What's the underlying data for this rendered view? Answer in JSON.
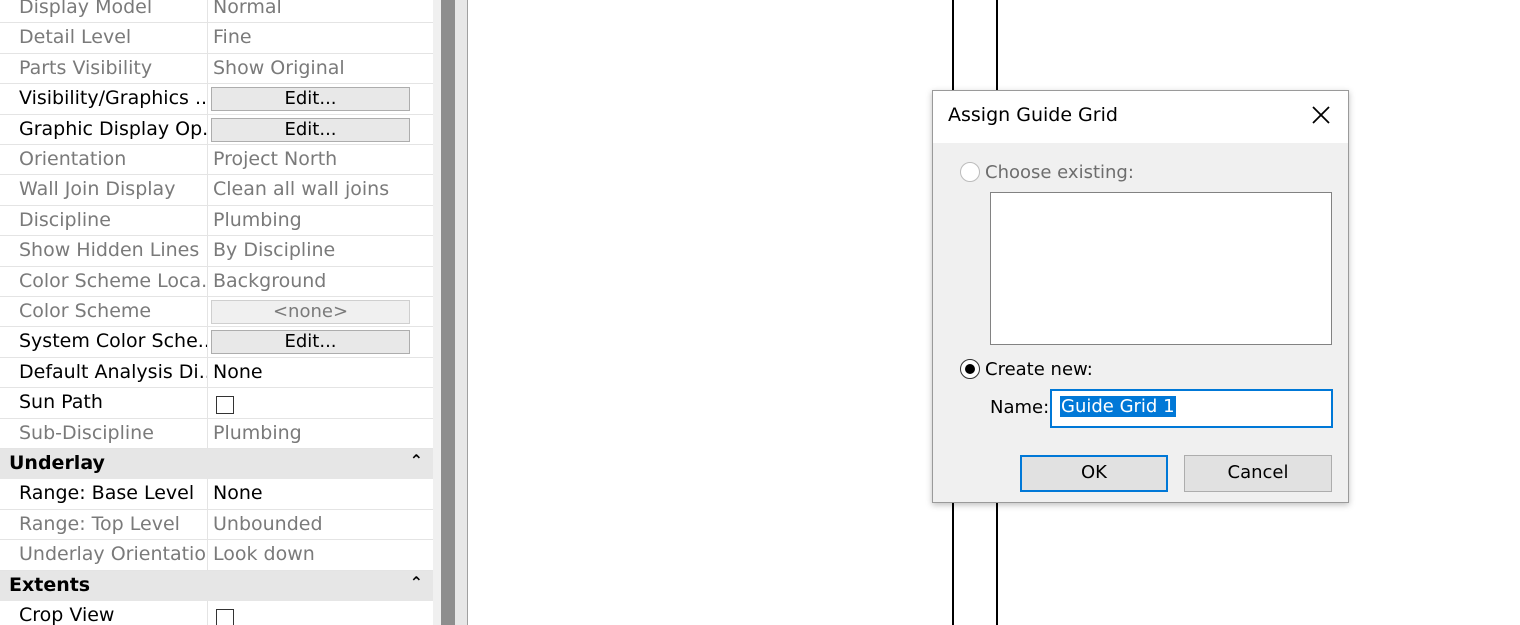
{
  "properties": {
    "rows": [
      {
        "label": "Display Model",
        "value": "Normal",
        "kind": "text",
        "dim": true
      },
      {
        "label": "Detail Level",
        "value": "Fine",
        "kind": "text",
        "dim": true
      },
      {
        "label": "Parts Visibility",
        "value": "Show Original",
        "kind": "text",
        "dim": true
      },
      {
        "label": "Visibility/Graphics ...",
        "value": "Edit...",
        "kind": "button",
        "dim": false
      },
      {
        "label": "Graphic Display Op...",
        "value": "Edit...",
        "kind": "button",
        "dim": false
      },
      {
        "label": "Orientation",
        "value": "Project North",
        "kind": "text",
        "dim": true
      },
      {
        "label": "Wall Join Display",
        "value": "Clean all wall joins",
        "kind": "text",
        "dim": true
      },
      {
        "label": "Discipline",
        "value": "Plumbing",
        "kind": "text",
        "dim": true
      },
      {
        "label": "Show Hidden Lines",
        "value": "By Discipline",
        "kind": "text",
        "dim": true
      },
      {
        "label": "Color Scheme Loca...",
        "value": "Background",
        "kind": "text",
        "dim": true
      },
      {
        "label": "Color Scheme",
        "value": "<none>",
        "kind": "button",
        "dim": true
      },
      {
        "label": "System Color Sche...",
        "value": "Edit...",
        "kind": "button",
        "dim": false
      },
      {
        "label": "Default Analysis Di...",
        "value": "None",
        "kind": "text",
        "dim": false
      },
      {
        "label": "Sun Path",
        "value": "",
        "kind": "checkbox",
        "dim": false
      },
      {
        "label": "Sub-Discipline",
        "value": "Plumbing",
        "kind": "text",
        "dim": true
      },
      {
        "group": "Underlay",
        "icon": "collapse-icon"
      },
      {
        "label": "Range: Base Level",
        "value": "None",
        "kind": "text",
        "dim": false
      },
      {
        "label": "Range: Top Level",
        "value": "Unbounded",
        "kind": "text",
        "dim": true
      },
      {
        "label": "Underlay Orientation",
        "value": "Look down",
        "kind": "text",
        "dim": true
      },
      {
        "group": "Extents",
        "icon": "collapse-icon"
      },
      {
        "label": "Crop View",
        "value": "",
        "kind": "checkbox",
        "dim": false
      }
    ],
    "collapse_glyph": "⌃"
  },
  "dialog": {
    "title": "Assign Guide Grid",
    "choose_existing_label": "Choose existing:",
    "create_new_label": "Create new:",
    "name_label": "Name:",
    "name_value": "Guide Grid 1",
    "ok_label": "OK",
    "cancel_label": "Cancel",
    "accent": "#0078d7"
  }
}
